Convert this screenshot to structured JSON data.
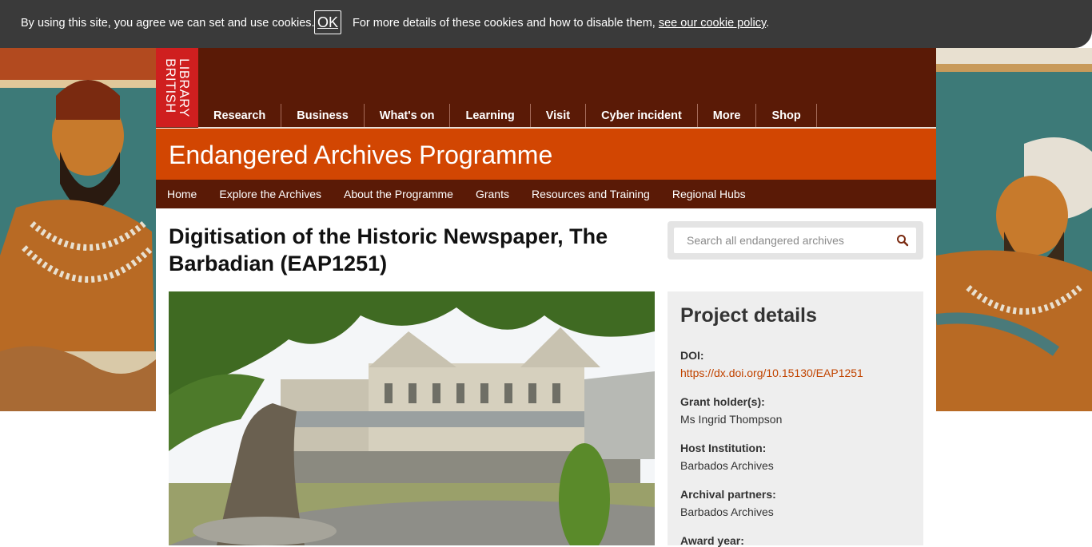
{
  "cookie_bar": {
    "text": "By using this site, you agree we can set and use cookies.",
    "ok_label": "OK",
    "more_text": "For more details of these cookies and how to disable them, ",
    "policy_link": "see our cookie policy",
    "end_punct": "."
  },
  "header": {
    "logo_line1": "BRITISH",
    "logo_line2": "LIBRARY",
    "nav": [
      "Research",
      "Business",
      "What's on",
      "Learning",
      "Visit",
      "Cyber incident",
      "More",
      "Shop"
    ]
  },
  "programme": {
    "title": "Endangered Archives Programme",
    "nav": [
      "Home",
      "Explore the Archives",
      "About the Programme",
      "Grants",
      "Resources and Training",
      "Regional Hubs"
    ]
  },
  "page": {
    "title": "Digitisation of the Historic Newspaper, The Barbadian (EAP1251)"
  },
  "search": {
    "placeholder": "Search all endangered archives",
    "icon": "search-icon"
  },
  "project_details": {
    "heading": "Project details",
    "doi_label": "DOI:",
    "doi_value": "https://dx.doi.org/10.15130/EAP1251",
    "grant_holder_label": "Grant holder(s):",
    "grant_holder_value": "Ms Ingrid Thompson",
    "host_label": "Host Institution:",
    "host_value": "Barbados Archives",
    "partners_label": "Archival partners:",
    "partners_value": "Barbados Archives",
    "award_year_label": "Award year:"
  },
  "colors": {
    "header_brown": "#5a1a06",
    "programme_orange": "#d24602",
    "logo_red": "#cf1f1f",
    "link_orange": "#c14400",
    "cookie_bar": "#3a3a3a"
  }
}
